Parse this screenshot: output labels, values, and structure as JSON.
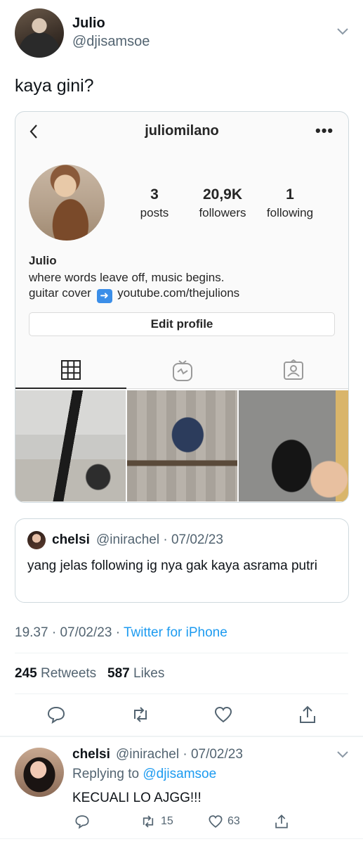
{
  "tweet": {
    "author_name": "Julio",
    "author_handle": "@djisamsoe",
    "text": "kaya gini?",
    "time": "19.37",
    "date": "07/02/23",
    "source": "Twitter for iPhone",
    "retweets_count": "245",
    "retweets_label": "Retweets",
    "likes_count": "587",
    "likes_label": "Likes"
  },
  "instagram_card": {
    "username": "juliomilano",
    "posts_count": "3",
    "posts_label": "posts",
    "followers_count": "20,9K",
    "followers_label": "followers",
    "following_count": "1",
    "following_label": "following",
    "bio_name": "Julio",
    "bio_line1": "where words leave off, music begins.",
    "bio_line2_prefix": "guitar cover",
    "bio_link": "youtube.com/thejulions",
    "edit_button_label": "Edit profile"
  },
  "quote": {
    "name": "chelsi",
    "handle": "@inirachel",
    "date": "07/02/23",
    "text": "yang jelas following ig nya gak kaya asrama putri"
  },
  "reply": {
    "name": "chelsi",
    "handle": "@inirachel",
    "date": "07/02/23",
    "replying_prefix": "Replying to",
    "replying_handle": "@djisamsoe",
    "text": "KECUALI LO AJGG!!!",
    "retweet_count": "15",
    "like_count": "63"
  },
  "icons": [
    "chevron-down-icon",
    "back-arrow-icon",
    "more-icon",
    "grid-icon",
    "igtv-icon",
    "tagged-icon",
    "reply-icon",
    "retweet-icon",
    "like-icon",
    "share-icon"
  ],
  "colors": {
    "link_blue": "#1d9bf0",
    "muted": "#536471",
    "text": "#0f1419"
  }
}
